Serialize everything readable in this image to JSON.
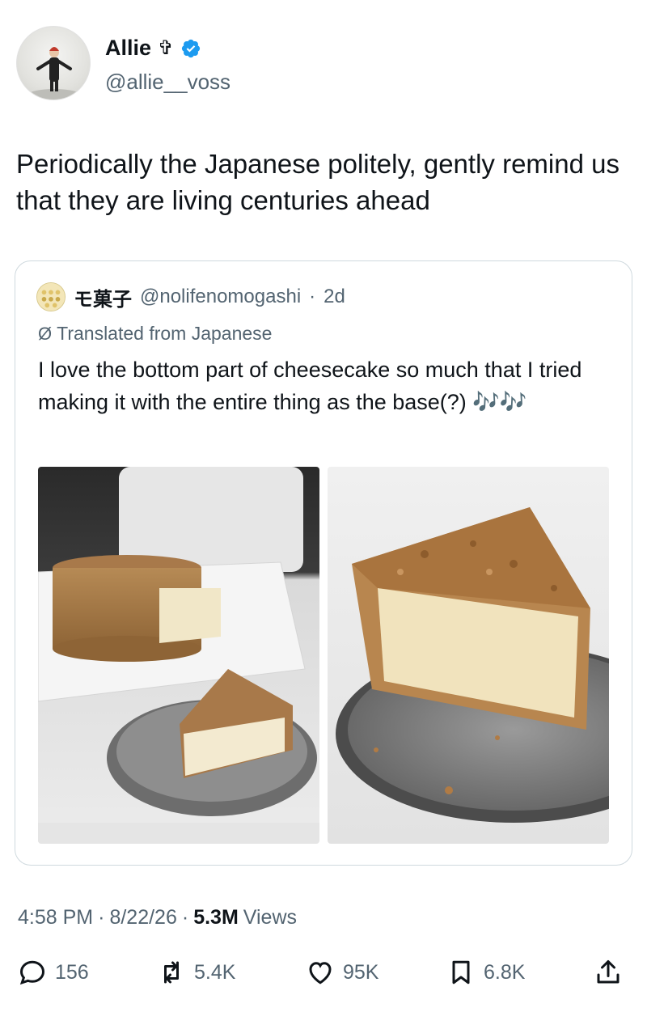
{
  "author": {
    "display_name": "Allie",
    "name_symbol": "✞",
    "handle": "@allie__voss",
    "verified": true
  },
  "tweet": {
    "text": "Periodically the Japanese politely, gently remind us that they are living centuries ahead"
  },
  "quote": {
    "display_name": "モ菓子",
    "handle": "@nolifenomogashi",
    "separator": "·",
    "time": "2d",
    "translated_label": "Translated from Japanese",
    "text": "I love the bottom part of cheesecake so much that I tried making it with the entire thing as the base(?) 🎶🎶",
    "photos": [
      "cheesecake-whole-photo",
      "cheesecake-slice-photo"
    ]
  },
  "meta": {
    "time": "4:58 PM",
    "sep1": "·",
    "date": "8/22/26",
    "sep2": "·",
    "views_count": "5.3M",
    "views_label": "Views"
  },
  "actions": {
    "replies": "156",
    "reposts": "5.4K",
    "likes": "95K",
    "bookmarks": "6.8K"
  },
  "colors": {
    "text": "#0f1419",
    "secondary": "#536471",
    "verified": "#1d9bf0",
    "border": "#cfd9de"
  }
}
